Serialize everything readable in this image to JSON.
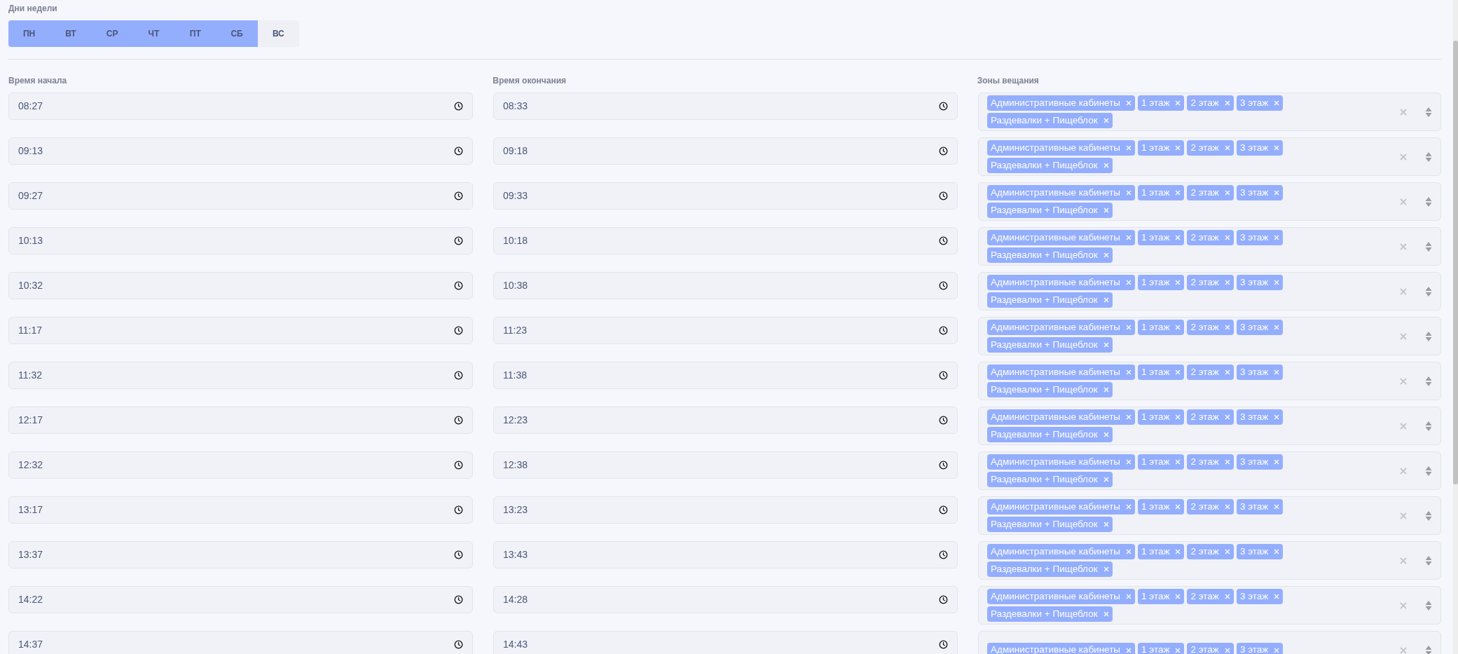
{
  "days": {
    "label": "Дни недели",
    "items": [
      {
        "label": "ПН",
        "selected": true
      },
      {
        "label": "ВТ",
        "selected": true
      },
      {
        "label": "СР",
        "selected": true
      },
      {
        "label": "ЧТ",
        "selected": true
      },
      {
        "label": "ПТ",
        "selected": true
      },
      {
        "label": "СБ",
        "selected": true
      },
      {
        "label": "ВС",
        "selected": false
      }
    ]
  },
  "columns": {
    "start": "Время начала",
    "end": "Время окончания",
    "zones": "Зоны вещания"
  },
  "rows": [
    {
      "start": "08:27",
      "end": "08:33",
      "zones": [
        "Административные кабинеты",
        "1 этаж",
        "2 этаж",
        "3 этаж",
        "Раздевалки + Пищеблок"
      ]
    },
    {
      "start": "09:13",
      "end": "09:18",
      "zones": [
        "Административные кабинеты",
        "1 этаж",
        "2 этаж",
        "3 этаж",
        "Раздевалки + Пищеблок"
      ]
    },
    {
      "start": "09:27",
      "end": "09:33",
      "zones": [
        "Административные кабинеты",
        "1 этаж",
        "2 этаж",
        "3 этаж",
        "Раздевалки + Пищеблок"
      ]
    },
    {
      "start": "10:13",
      "end": "10:18",
      "zones": [
        "Административные кабинеты",
        "1 этаж",
        "2 этаж",
        "3 этаж",
        "Раздевалки + Пищеблок"
      ]
    },
    {
      "start": "10:32",
      "end": "10:38",
      "zones": [
        "Административные кабинеты",
        "1 этаж",
        "2 этаж",
        "3 этаж",
        "Раздевалки + Пищеблок"
      ]
    },
    {
      "start": "11:17",
      "end": "11:23",
      "zones": [
        "Административные кабинеты",
        "1 этаж",
        "2 этаж",
        "3 этаж",
        "Раздевалки + Пищеблок"
      ]
    },
    {
      "start": "11:32",
      "end": "11:38",
      "zones": [
        "Административные кабинеты",
        "1 этаж",
        "2 этаж",
        "3 этаж",
        "Раздевалки + Пищеблок"
      ]
    },
    {
      "start": "12:17",
      "end": "12:23",
      "zones": [
        "Административные кабинеты",
        "1 этаж",
        "2 этаж",
        "3 этаж",
        "Раздевалки + Пищеблок"
      ]
    },
    {
      "start": "12:32",
      "end": "12:38",
      "zones": [
        "Административные кабинеты",
        "1 этаж",
        "2 этаж",
        "3 этаж",
        "Раздевалки + Пищеблок"
      ]
    },
    {
      "start": "13:17",
      "end": "13:23",
      "zones": [
        "Административные кабинеты",
        "1 этаж",
        "2 этаж",
        "3 этаж",
        "Раздевалки + Пищеблок"
      ]
    },
    {
      "start": "13:37",
      "end": "13:43",
      "zones": [
        "Административные кабинеты",
        "1 этаж",
        "2 этаж",
        "3 этаж",
        "Раздевалки + Пищеблок"
      ]
    },
    {
      "start": "14:22",
      "end": "14:28",
      "zones": [
        "Административные кабинеты",
        "1 этаж",
        "2 этаж",
        "3 этаж",
        "Раздевалки + Пищеблок"
      ]
    },
    {
      "start": "14:37",
      "end": "14:43",
      "zones": [
        "Административные кабинеты",
        "1 этаж",
        "2 этаж",
        "3 этаж"
      ]
    }
  ]
}
